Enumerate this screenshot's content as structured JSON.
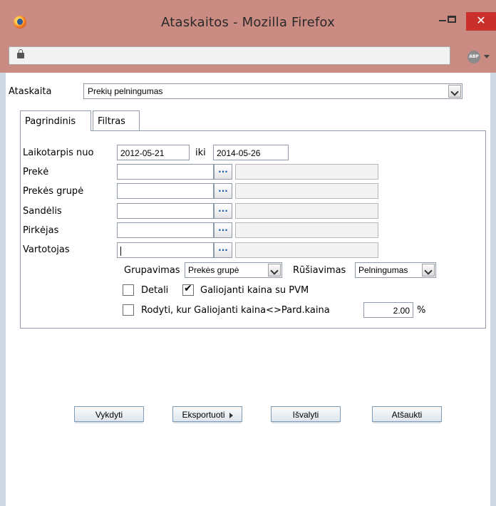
{
  "window": {
    "title": "Ataskaitos - Mozilla Firefox",
    "close_glyph": "✕",
    "abp_label": "ABP"
  },
  "report": {
    "label": "Ataskaita",
    "selected": "Prekių pelningumas"
  },
  "tabs": [
    {
      "label": "Pagrindinis"
    },
    {
      "label": "Filtras"
    }
  ],
  "period": {
    "label": "Laikotarpis nuo",
    "from": "2012-05-21",
    "to_label": "iki",
    "to": "2014-05-26"
  },
  "filters": [
    {
      "label": "Prekė",
      "value": ""
    },
    {
      "label": "Prekės grupė",
      "value": ""
    },
    {
      "label": "Sandėlis",
      "value": ""
    },
    {
      "label": "Pirkėjas",
      "value": ""
    },
    {
      "label": "Vartotojas",
      "value": ""
    }
  ],
  "browse_label": "...",
  "grouping": {
    "label": "Grupavimas",
    "selected": "Prekės grupė"
  },
  "sorting": {
    "label": "Rūšiavimas",
    "selected": "Pelningumas"
  },
  "options": {
    "detail": {
      "label": "Detali",
      "checked": false
    },
    "valid_price_vat": {
      "label": "Galiojanti kaina su PVM",
      "checked": true
    },
    "show_diff": {
      "label": "Rodyti, kur Galiojanti kaina<>Pard.kaina",
      "checked": false,
      "value": "2.00",
      "unit": "%"
    }
  },
  "actions": {
    "run": "Vykdyti",
    "export": "Eksportuoti",
    "clear": "Išvalyti",
    "cancel": "Atšaukti"
  },
  "colors": {
    "titlebar": "#c98b82",
    "close": "#c9302c",
    "body": "#cfd9e3"
  }
}
